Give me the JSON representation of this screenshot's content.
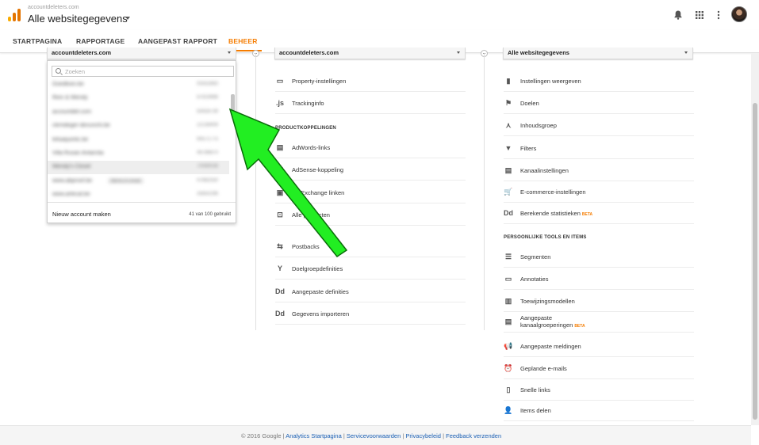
{
  "header": {
    "account_small": "accountdeleters.com",
    "property_title": "Alle websitegegevens",
    "logo_colors": [
      "#f9ab00",
      "#e37400",
      "#e37400"
    ]
  },
  "tabs": [
    {
      "label": "STARTPAGINA",
      "active": false
    },
    {
      "label": "RAPPORTAGE",
      "active": false
    },
    {
      "label": "AANGEPAST RAPPORT",
      "active": false
    },
    {
      "label": "BEHEER",
      "active": true
    }
  ],
  "account_column": {
    "selector_label": "accountdeleters.com",
    "search_placeholder": "Zoeken",
    "accounts": [
      {
        "name": "Goedkoin.be",
        "id": "91632863"
      },
      {
        "name": "Rein & Wendy",
        "id": "87619988"
      },
      {
        "name": "accountdel.com",
        "id": "83428739"
      },
      {
        "name": "clemdeger-devunchi.be",
        "id": "22138409"
      },
      {
        "name": "tetsaquintic.be",
        "id": "64571775"
      },
      {
        "name": "Villa Ruxan Antarctia",
        "id": "46788870"
      },
      {
        "name": "Wendy's Closet",
        "id": "70089038"
      },
      {
        "name": "www.abproof.be",
        "extra": "bkms.lr.creat",
        "id": "47882550"
      },
      {
        "name": "www.artecal.be",
        "id": "35650296"
      }
    ],
    "new_account_label": "Nieuw account maken",
    "usage_label": "41 van 100 gebruikt"
  },
  "property_column": {
    "selector_label": "accountdeleters.com",
    "items": [
      {
        "label": "Property-instellingen",
        "icon": "property-settings-icon",
        "glyph": "▭"
      },
      {
        "label": "Trackinginfo",
        "icon": "js-icon",
        "glyph": ".js"
      }
    ],
    "section_title": "PRODUCTKOPPELINGEN",
    "link_items": [
      {
        "label": "AdWords-links",
        "icon": "adwords-icon",
        "glyph": "▤"
      },
      {
        "label": "AdSense-koppeling",
        "icon": "adsense-icon",
        "glyph": "▤"
      },
      {
        "label": "Ad Exchange linken",
        "icon": "adexchange-icon",
        "glyph": "▣"
      },
      {
        "label": "Alle producten",
        "icon": "all-products-icon",
        "glyph": "⊡"
      }
    ],
    "other_items": [
      {
        "label": "Postbacks",
        "icon": "postbacks-icon",
        "glyph": "⇆"
      },
      {
        "label": "Doelgroepdefinities",
        "icon": "audience-icon",
        "glyph": "Y"
      },
      {
        "label": "Aangepaste definities",
        "icon": "custom-definitions-icon",
        "glyph": "Dd"
      },
      {
        "label": "Gegevens importeren",
        "icon": "data-import-icon",
        "glyph": "Dd"
      }
    ]
  },
  "view_column": {
    "selector_label": "Alle websitegegevens",
    "items": [
      {
        "label": "Instellingen weergeven",
        "icon": "view-settings-icon",
        "glyph": "▮"
      },
      {
        "label": "Doelen",
        "icon": "flag-icon",
        "glyph": "⚑"
      },
      {
        "label": "Inhoudsgroep",
        "icon": "content-grouping-icon",
        "glyph": "⋏"
      },
      {
        "label": "Filters",
        "icon": "filter-icon",
        "glyph": "▼"
      },
      {
        "label": "Kanaalinstellingen",
        "icon": "channel-settings-icon",
        "glyph": "▤"
      },
      {
        "label": "E-commerce-instellingen",
        "icon": "cart-icon",
        "glyph": "🛒"
      },
      {
        "label": "Berekende statistieken",
        "icon": "calculated-metrics-icon",
        "glyph": "Dd",
        "badge": "BETA"
      }
    ],
    "section_title": "PERSOONLIJKE TOOLS EN ITEMS",
    "personal_items": [
      {
        "label": "Segmenten",
        "icon": "segments-icon",
        "glyph": "☰"
      },
      {
        "label": "Annotaties",
        "icon": "annotations-icon",
        "glyph": "▭"
      },
      {
        "label": "Toewijzingsmodellen",
        "icon": "attribution-icon",
        "glyph": "▥"
      },
      {
        "label": "Aangepaste kanaalgroeperingen",
        "icon": "custom-channel-icon",
        "glyph": "▤",
        "badge": "BETA"
      },
      {
        "label": "Aangepaste meldingen",
        "icon": "alerts-icon",
        "glyph": "📢"
      },
      {
        "label": "Geplande e-mails",
        "icon": "scheduled-email-icon",
        "glyph": "⏰"
      },
      {
        "label": "Snelle links",
        "icon": "shortcuts-icon",
        "glyph": "▯"
      },
      {
        "label": "Items delen",
        "icon": "share-assets-icon",
        "glyph": "👤"
      }
    ]
  },
  "footer": {
    "copyright": "© 2016 Google",
    "links": [
      "Analytics Startpagina",
      "Servicevoorwaarden",
      "Privacybeleid",
      "Feedback verzenden"
    ],
    "separator": " | "
  },
  "annotation": {
    "arrow_color": "#22ee22"
  }
}
